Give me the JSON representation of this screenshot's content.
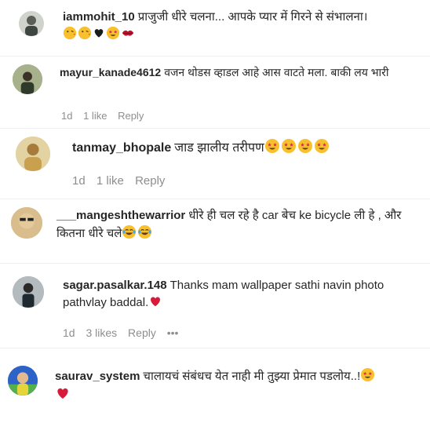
{
  "comments": [
    {
      "username": "iammohit_10",
      "text": "प्राजुजी धीरे चलना... आपके प्यार में गिरने से संभालना।",
      "emojis": [
        "face-blowing-kiss",
        "face-blowing-kiss",
        "black-heart",
        "star-struck",
        "kiss-mark"
      ],
      "avatar_color": "#cfd3cc",
      "meta": null
    },
    {
      "username": "mayur_kanade4612",
      "text": "वजन थोडस व्हाडल आहे आस वाटते मला. बाकी लय भारी",
      "emojis": [],
      "avatar_color": "#8d9a7a",
      "meta": {
        "time": "1d",
        "likes": "1 like",
        "reply": "Reply"
      }
    },
    {
      "username": "tanmay_bhopale",
      "text": "जाड झालीय तरीपण",
      "emojis": [
        "star-struck",
        "star-struck",
        "star-struck",
        "star-struck"
      ],
      "avatar_color": "#d6c28a",
      "meta": {
        "time": "1d",
        "likes": "1 like",
        "reply": "Reply"
      }
    },
    {
      "username": "___mangeshthewarrior",
      "text": "धीरे ही चल रहे है car बेच ke bicycle ली हे , और कितना धीरे चले",
      "emojis": [
        "tears-of-joy",
        "tears-of-joy"
      ],
      "avatar_color": "#c8a878",
      "meta": null
    },
    {
      "username": "sagar.pasalkar.148",
      "text": "Thanks mam wallpaper sathi navin photo pathvlay baddal.",
      "emojis": [
        "red-heart"
      ],
      "avatar_color": "#9aa3a7",
      "meta": {
        "time": "1d",
        "likes": "3 likes",
        "reply": "Reply",
        "more": "•••"
      }
    },
    {
      "username": "saurav_system",
      "text": "चालायचं संबंधच येत नाही मी तुझ्या प्रेमात पडलोय..!",
      "emojis": [
        "star-struck",
        "red-heart"
      ],
      "avatar_color": "#3a6fd0",
      "meta": null
    }
  ]
}
